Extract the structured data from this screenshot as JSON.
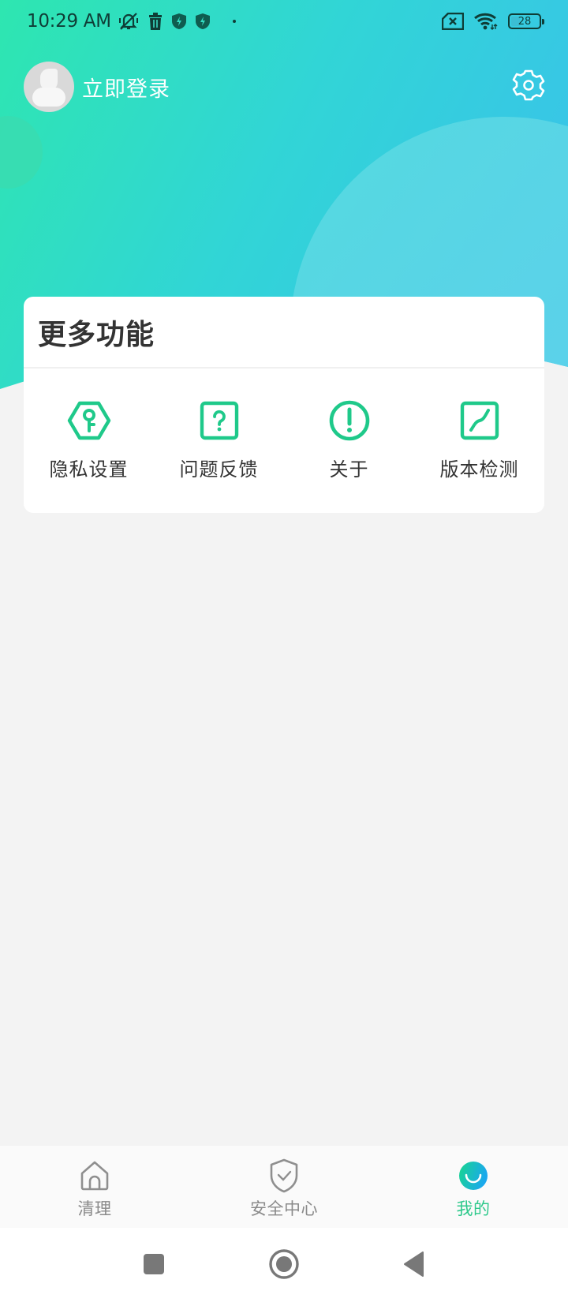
{
  "status_bar": {
    "time": "10:29 AM",
    "left_icons": [
      "notifications-muted-icon",
      "trash-icon",
      "shield-bolt-icon",
      "shield-bolt-icon",
      "dot-icon"
    ],
    "right_icons": [
      "no-sim-icon",
      "wifi-icon",
      "battery-icon"
    ],
    "battery_level": "28",
    "battery_percent": 28
  },
  "header": {
    "login_label": "立即登录",
    "avatar_icon": "default-avatar-icon",
    "settings_icon": "gear-icon",
    "gradient_start": "#2ee6b0",
    "gradient_end": "#3ac4e8"
  },
  "more_features": {
    "title": "更多功能",
    "accent_color": "#1fc98a",
    "items": [
      {
        "label": "隐私设置",
        "icon": "privacy-key-icon"
      },
      {
        "label": "问题反馈",
        "icon": "question-square-icon"
      },
      {
        "label": "关于",
        "icon": "info-exclamation-icon"
      },
      {
        "label": "版本检测",
        "icon": "version-curve-icon"
      }
    ]
  },
  "tab_bar": {
    "active_index": 2,
    "active_color": "#2ec98c",
    "tabs": [
      {
        "label": "清理",
        "icon": "home-icon"
      },
      {
        "label": "安全中心",
        "icon": "shield-check-icon"
      },
      {
        "label": "我的",
        "icon": "smile-profile-icon"
      }
    ]
  },
  "system_nav": {
    "buttons": [
      "recents-icon",
      "home-circle-icon",
      "back-triangle-icon"
    ]
  }
}
